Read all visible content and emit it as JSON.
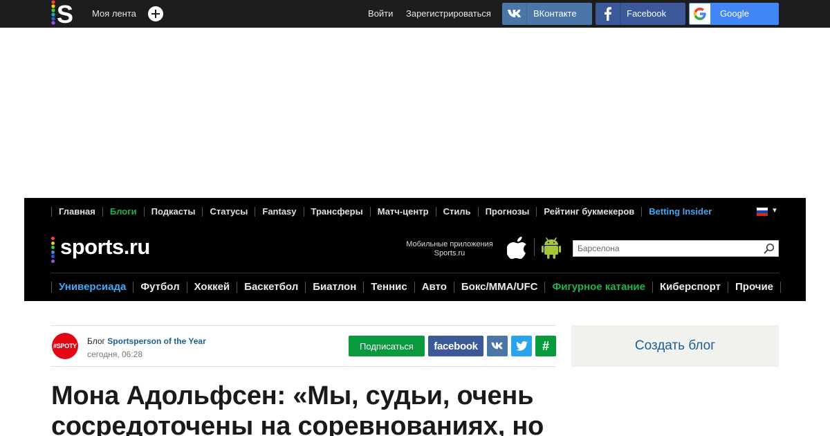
{
  "topbar": {
    "my_feed": "Моя лента",
    "login": "Войти",
    "register": "Зарегистрироваться",
    "social": {
      "vk": "ВКонтакте",
      "facebook": "Facebook",
      "google": "Google"
    }
  },
  "site_nav": {
    "items": [
      {
        "label": "Главная",
        "style": "normal"
      },
      {
        "label": "Блоги",
        "style": "green"
      },
      {
        "label": "Подкасты",
        "style": "normal"
      },
      {
        "label": "Статусы",
        "style": "normal"
      },
      {
        "label": "Fantasy",
        "style": "normal"
      },
      {
        "label": "Трансферы",
        "style": "normal"
      },
      {
        "label": "Матч-центр",
        "style": "normal"
      },
      {
        "label": "Стиль",
        "style": "normal"
      },
      {
        "label": "Прогнозы",
        "style": "normal"
      },
      {
        "label": "Рейтинг букмекеров",
        "style": "normal"
      },
      {
        "label": "Betting Insider",
        "style": "blue"
      }
    ]
  },
  "brand": {
    "logo_text": "sports.ru",
    "mobile_apps": "Мобильные приложения Sports.ru"
  },
  "search": {
    "placeholder": "Барселона"
  },
  "sports_nav": {
    "items": [
      {
        "label": "Универсиада",
        "style": "blue"
      },
      {
        "label": "Футбол",
        "style": "normal"
      },
      {
        "label": "Хоккей",
        "style": "normal"
      },
      {
        "label": "Баскетбол",
        "style": "normal"
      },
      {
        "label": "Биатлон",
        "style": "normal"
      },
      {
        "label": "Теннис",
        "style": "normal"
      },
      {
        "label": "Авто",
        "style": "normal"
      },
      {
        "label": "Бокс/MMA/UFC",
        "style": "normal"
      },
      {
        "label": "Фигурное катание",
        "style": "green"
      },
      {
        "label": "Киберспорт",
        "style": "normal"
      },
      {
        "label": "Прочие",
        "style": "normal"
      }
    ]
  },
  "blog": {
    "avatar_text": "#SPOTY",
    "prefix": "Блог",
    "name": "Sportsperson of the Year",
    "time": "сегодня, 06:28",
    "subscribe": "Подписаться",
    "facebook": "facebook",
    "hash": "#"
  },
  "sidebar": {
    "create_blog": "Создать блог"
  },
  "article": {
    "headline": "Мона Адольфсен: «Мы, судьи, очень сосредоточены на соревнованиях, но"
  },
  "colors": {
    "topbar": "#1d1d1d",
    "header": "#000000",
    "green": "#0a9a3e",
    "link_blue": "#1a5e91",
    "nav_blue": "#3fa9f5",
    "vk": "#4a76a8",
    "facebook": "#3b5998",
    "twitter": "#2aa3ef",
    "google": "#4285f4"
  }
}
